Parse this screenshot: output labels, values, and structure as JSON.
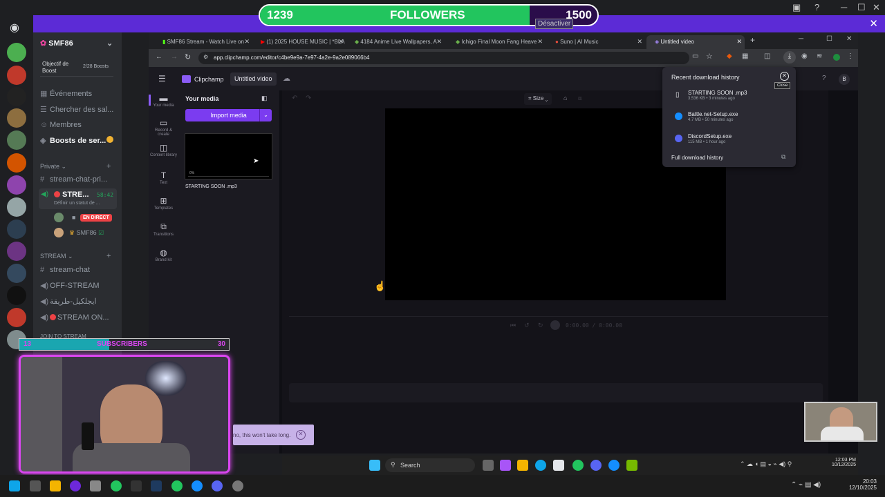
{
  "overlay": {
    "followers_current": "1239",
    "followers_label": "FOLLOWERS",
    "followers_goal": "1500",
    "followers_progress": 0.8,
    "desactiver": "Désactiver",
    "subs_current": "13",
    "subs_label": "SUBSCRIBERS",
    "subs_goal": "30",
    "subs_progress": 0.43
  },
  "discord": {
    "server_name": "SMF86",
    "boost_goal": "Objectif de Boost",
    "boost_count": "2/28 Boosts",
    "menu": [
      "Événements",
      "Chercher des sal...",
      "Membres",
      "Boosts de ser..."
    ],
    "private_header": "Private",
    "private_channels": [
      "stream-chat-pri..."
    ],
    "voice_channel": "STRE...",
    "voice_time": "58:42",
    "voice_status": "Définir un statut de ...",
    "live_badge": "EN DIRECT",
    "user_name": "SMF86",
    "stream_header": "STREAM",
    "stream_channels": [
      "stream-chat",
      "OFF-STREAM",
      "ايجلكيل-طريقة",
      "STREAM ON..."
    ],
    "join_stream": "JOIN TO STREAM"
  },
  "browser": {
    "tabs": [
      {
        "label": "SMF86 Stream - Watch Live on",
        "active": false
      },
      {
        "label": "(1) 2025 HOUSE MUSIC | *BLA",
        "active": false
      },
      {
        "label": "4184 Anime Live Wallpapers, A",
        "active": false
      },
      {
        "label": "Ichigo Final Moon Fang Heave",
        "active": false
      },
      {
        "label": "Suno | AI Music",
        "active": false
      },
      {
        "label": "Untitled video",
        "active": true
      }
    ],
    "url": "app.clipchamp.com/editor/c4be9e9a-7e97-4a2e-9a2e089066b4"
  },
  "clipchamp": {
    "app_name": "Clipchamp",
    "project_name": "Untitled video",
    "left_nav": [
      {
        "icon": "media-icon",
        "label": "Your media"
      },
      {
        "icon": "record-icon",
        "label": "Record & create"
      },
      {
        "icon": "library-icon",
        "label": "Content library"
      },
      {
        "icon": "text-icon",
        "label": "Text"
      },
      {
        "icon": "templates-icon",
        "label": "Templates"
      },
      {
        "icon": "transitions-icon",
        "label": "Transitions"
      },
      {
        "icon": "brand-icon",
        "label": "Brand kit"
      }
    ],
    "media_title": "Your media",
    "import_label": "Import media",
    "thumb_progress": "0%",
    "thumb_name": "STARTING SOON .mp3",
    "size_label": "Size",
    "time_display": "0:00.00 / 0:00.00",
    "avatar_letter": "B"
  },
  "downloads": {
    "title": "Recent download history",
    "close_tooltip": "Close",
    "items": [
      {
        "name": "STARTING SOON .mp3",
        "meta": "3,536 KB • 3 minutes ago",
        "color": "#e8eaed"
      },
      {
        "name": "Battle.net-Setup.exe",
        "meta": "4.7 MB • 50 minutes ago",
        "color": "#148eff"
      },
      {
        "name": "DiscordSetup.exe",
        "meta": "115 MB • 1 hour ago",
        "color": "#5865f2"
      }
    ],
    "full_history": "Full download history"
  },
  "toast": {
    "text": "no, this won't take long."
  },
  "taskbar": {
    "search_label": "Search",
    "inner_time": "12:03 PM",
    "inner_date": "10/12/2025",
    "outer_time": "20:03",
    "outer_date": "12/10/2025"
  },
  "colors": {
    "accent": "#7b3cf0",
    "discord_purple": "#5c2bd6",
    "live_red": "#ed4245",
    "overlay_pink": "#d946ef"
  }
}
